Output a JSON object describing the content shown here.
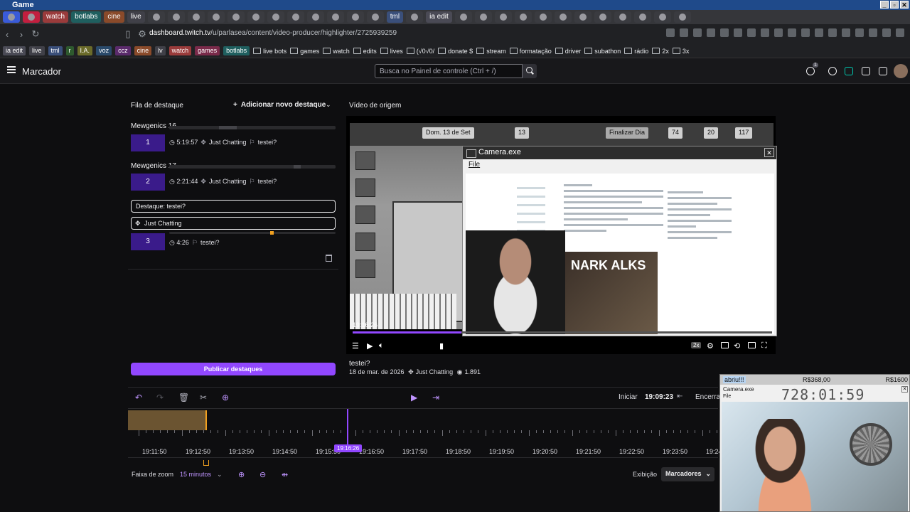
{
  "os_window": {
    "title": "Game"
  },
  "browser": {
    "tabs": [
      {
        "label": "",
        "color": "#3a5bd8"
      },
      {
        "label": "",
        "color": "#c21f3f"
      },
      {
        "label": "watch",
        "color": "#9a3b3b"
      },
      {
        "label": "botlabs",
        "color": "#1f5f5f"
      },
      {
        "label": "cine",
        "color": "#8a4a2a"
      },
      {
        "label": "live",
        "color": "#404048"
      },
      {
        "label": "",
        "color": "#3a3b40"
      },
      {
        "label": "",
        "color": "#3a3b40"
      },
      {
        "label": "",
        "color": "#3a3b40"
      },
      {
        "label": "",
        "color": "#3a3b40"
      },
      {
        "label": "",
        "color": "#3a3b40"
      },
      {
        "label": "",
        "color": "#3a3b40"
      },
      {
        "label": "",
        "color": "#3a3b40"
      },
      {
        "label": "",
        "color": "#3a3b40"
      },
      {
        "label": "",
        "color": "#3a3b40"
      },
      {
        "label": "",
        "color": "#3a3b40"
      },
      {
        "label": "",
        "color": "#3a3b40"
      },
      {
        "label": "",
        "color": "#3a3b40"
      },
      {
        "label": "tml",
        "color": "#3a4f7a"
      },
      {
        "label": "",
        "color": "#3a3b40"
      },
      {
        "label": "ia edit",
        "color": "#4a4a55"
      },
      {
        "label": "",
        "color": "#3a3b40"
      },
      {
        "label": "",
        "color": "#3a3b40"
      },
      {
        "label": "",
        "color": "#3a3b40"
      },
      {
        "label": "",
        "color": "#3a3b40"
      },
      {
        "label": "",
        "color": "#3a3b40"
      },
      {
        "label": "",
        "color": "#3a3b40"
      },
      {
        "label": "",
        "color": "#3a3b40"
      },
      {
        "label": "",
        "color": "#3a3b40"
      },
      {
        "label": "",
        "color": "#3a3b40"
      },
      {
        "label": "",
        "color": "#3a3b40"
      },
      {
        "label": "",
        "color": "#3a3b40"
      },
      {
        "label": "",
        "color": "#3a3b40"
      }
    ],
    "url_host": "dashboard.twitch.tv",
    "url_path": "/u/parlasea/content/video-producer/highlighter/2725939259",
    "bookmarks": [
      {
        "label": "ia edit",
        "kind": "chip",
        "color": "#4a4a55"
      },
      {
        "label": "live",
        "kind": "chip",
        "color": "#404048"
      },
      {
        "label": "tml",
        "kind": "chip",
        "color": "#3a4f7a"
      },
      {
        "label": "r",
        "kind": "chip",
        "color": "#2e5a2e"
      },
      {
        "label": "I.A.",
        "kind": "chip",
        "color": "#6b6b2a"
      },
      {
        "label": "voz",
        "kind": "chip",
        "color": "#2a4a6b"
      },
      {
        "label": "ccz",
        "kind": "chip",
        "color": "#5a2a6b"
      },
      {
        "label": "cine",
        "kind": "chip",
        "color": "#8a4a2a"
      },
      {
        "label": "lv",
        "kind": "chip",
        "color": "#404048"
      },
      {
        "label": "watch",
        "kind": "chip",
        "color": "#9a3b3b"
      },
      {
        "label": "games",
        "kind": "chip",
        "color": "#7a2a4a"
      },
      {
        "label": "botlabs",
        "kind": "chip",
        "color": "#1f5f5f"
      },
      {
        "label": "live bots",
        "kind": "folder"
      },
      {
        "label": "games",
        "kind": "folder"
      },
      {
        "label": "watch",
        "kind": "folder"
      },
      {
        "label": "edits",
        "kind": "folder"
      },
      {
        "label": "lives",
        "kind": "folder"
      },
      {
        "label": "(√0√0/",
        "kind": "folder"
      },
      {
        "label": "donate $",
        "kind": "folder"
      },
      {
        "label": "stream",
        "kind": "folder"
      },
      {
        "label": "formatação",
        "kind": "folder"
      },
      {
        "label": "driver",
        "kind": "folder"
      },
      {
        "label": "subathon",
        "kind": "folder"
      },
      {
        "label": "rádio",
        "kind": "folder"
      },
      {
        "label": "2x",
        "kind": "folder"
      },
      {
        "label": "3x",
        "kind": "folder"
      }
    ]
  },
  "header": {
    "title": "Marcador",
    "search_placeholder": "Busca no Painel de controle (Ctrl + /)",
    "notification_count": "1"
  },
  "queue": {
    "title": "Fila de destaque",
    "add_label": "Adicionar novo destaque",
    "groups": [
      {
        "title": "Mewgenics 16",
        "index": "1",
        "duration": "5:19:57",
        "category": "Just Chatting",
        "name": "testei?"
      },
      {
        "title": "Mewgenics 17",
        "index": "2",
        "duration": "2:21:44",
        "category": "Just Chatting",
        "name": "testei?"
      }
    ],
    "editing": {
      "title_field": "Destaque: testei?",
      "category_field": "Just Chatting",
      "index": "3",
      "duration": "4:26",
      "name": "testei?"
    },
    "publish_label": "Publicar destaques"
  },
  "source": {
    "title": "Vídeo de origem",
    "timestamp": "19:16:26",
    "progress_fraction": 0.26,
    "quality_badge": "2x",
    "game": {
      "date": "Dom. 13 de Set",
      "count_a": "13",
      "count_b": "74",
      "count_c": "20",
      "count_d": "117",
      "finish_label": "Finalizar Dia"
    },
    "camera_window": {
      "title": "Camera.exe",
      "menu_file": "File",
      "media_text": "NARK ALKS"
    }
  },
  "clip": {
    "title": "testei?",
    "date": "18 de mar. de 2026",
    "category": "Just Chatting",
    "views": "1.891"
  },
  "timeline": {
    "start_label": "Iniciar",
    "start_time": "19:09:23",
    "end_label": "Encerrar",
    "playhead_time": "19:16:26",
    "ticks": [
      "19:11:50",
      "19:12:50",
      "19:13:50",
      "19:14:50",
      "19:15:50",
      "19:16:50",
      "19:17:50",
      "19:18:50",
      "19:19:50",
      "19:20:50",
      "19:21:50",
      "19:22:50",
      "19:23:50",
      "19:24"
    ]
  },
  "zoom": {
    "label": "Faixa de zoom",
    "value": "15 minutos",
    "view_label": "Exibição",
    "view_value": "Marcadores"
  },
  "overlay": {
    "label": "abriu!!!",
    "price_1": "R$368,00",
    "price_2": "R$1600",
    "window_title": "Camera.exe",
    "menu_file": "File",
    "clock": "728:01:59"
  }
}
